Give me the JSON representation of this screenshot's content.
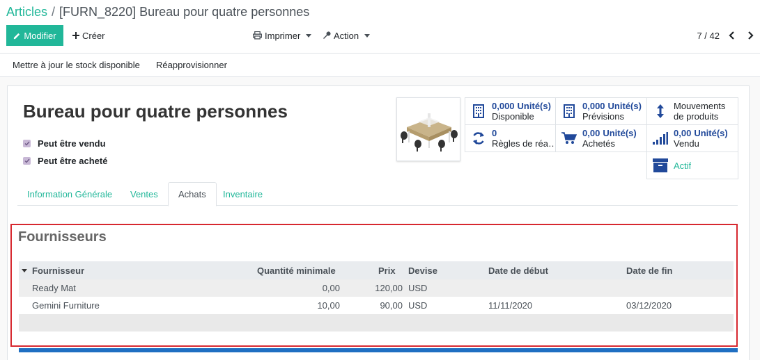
{
  "breadcrumb": {
    "parent": "Articles",
    "separator": "/",
    "current": "[FURN_8220] Bureau pour quatre personnes"
  },
  "toolbar": {
    "edit_label": "Modifier",
    "create_label": "Créer",
    "print_label": "Imprimer",
    "action_label": "Action",
    "pager": "7 / 42"
  },
  "statusbar": {
    "update_stock_label": "Mettre à jour le stock disponible",
    "replenish_label": "Réapprovisionner"
  },
  "product": {
    "name": "Bureau pour quatre personnes",
    "can_be_sold_label": "Peut être vendu",
    "can_be_purchased_label": "Peut être acheté"
  },
  "smart_buttons": {
    "available": {
      "value": "0,000",
      "unit": "Unité(s)",
      "label": "Disponible"
    },
    "forecast": {
      "value": "0,000",
      "unit": "Unité(s)",
      "label": "Prévisions"
    },
    "moves": {
      "label_line1": "Mouvements",
      "label_line2": "de produits"
    },
    "reorder_rules": {
      "value": "0",
      "label": "Règles de réa…"
    },
    "purchased": {
      "value": "0,00",
      "unit": "Unité(s)",
      "label": "Achetés"
    },
    "sold": {
      "value": "0,00",
      "unit": "Unité(s)",
      "label": "Vendu"
    },
    "active": {
      "label": "Actif"
    }
  },
  "tabs": [
    "Information Générale",
    "Ventes",
    "Achats",
    "Inventaire"
  ],
  "vendors": {
    "title": "Fournisseurs",
    "columns": {
      "vendor": "Fournisseur",
      "min_qty": "Quantité minimale",
      "price": "Prix",
      "currency": "Devise",
      "date_start": "Date de début",
      "date_end": "Date de fin"
    },
    "rows": [
      {
        "vendor": "Ready Mat",
        "min_qty": "0,00",
        "price": "120,00",
        "currency": "USD",
        "date_start": "",
        "date_end": ""
      },
      {
        "vendor": "Gemini Furniture",
        "min_qty": "10,00",
        "price": "90,00",
        "currency": "USD",
        "date_start": "11/11/2020",
        "date_end": "03/12/2020"
      }
    ]
  },
  "colors": {
    "brand_green": "#21b799",
    "value_blue": "#21499a",
    "highlight_red": "#d7282f",
    "bar_blue": "#1f6fc2"
  },
  "icons": {
    "edit": "pencil-icon",
    "create": "plus-icon",
    "print": "print-icon",
    "action": "wrench-icon",
    "prev": "chevron-left-icon",
    "next": "chevron-right-icon",
    "available": "building-icon",
    "forecast": "building-icon",
    "moves": "vertical-arrows-icon",
    "reorder": "refresh-icon",
    "purchased": "cart-icon",
    "sold": "signal-bars-icon",
    "active": "archive-icon"
  }
}
